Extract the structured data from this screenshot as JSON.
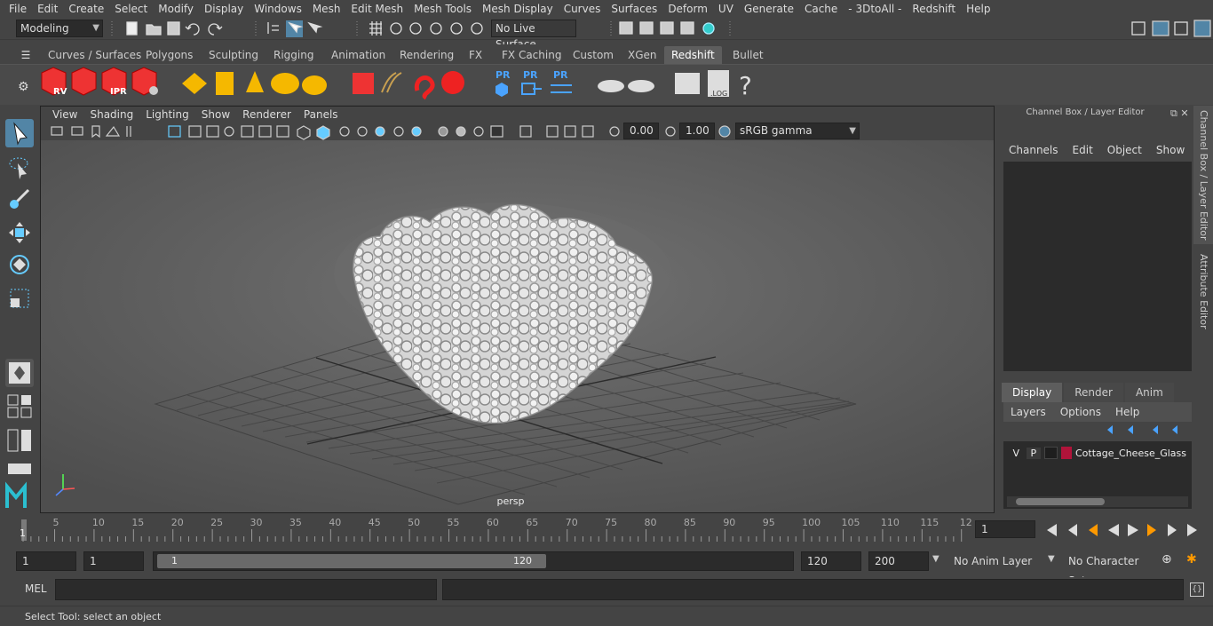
{
  "menubar": {
    "items": [
      "File",
      "Edit",
      "Create",
      "Select",
      "Modify",
      "Display",
      "Windows",
      "Mesh",
      "Edit Mesh",
      "Mesh Tools",
      "Mesh Display",
      "Curves",
      "Surfaces",
      "Deform",
      "UV",
      "Generate",
      "Cache",
      "- 3DtoAll -",
      "Redshift",
      "Help"
    ]
  },
  "statusline": {
    "mode": "Modeling",
    "live_surface": "No Live Surface"
  },
  "shelf": {
    "tabs": [
      "Curves / Surfaces",
      "Polygons",
      "Sculpting",
      "Rigging",
      "Animation",
      "Rendering",
      "FX",
      "FX Caching",
      "Custom",
      "XGen",
      "Redshift",
      "Bullet"
    ],
    "active": "Redshift",
    "icon_labels": {
      "rv": "RV",
      "ipr": "IPR",
      "pr1": "PR",
      "pr2": "PR",
      "pr3": "PR",
      "log": ".LOG",
      "help": "?"
    }
  },
  "panel": {
    "menus": [
      "View",
      "Shading",
      "Lighting",
      "Show",
      "Renderer",
      "Panels"
    ],
    "exposure": "0.00",
    "gamma": "1.00",
    "color_space": "sRGB gamma",
    "camera": "persp"
  },
  "channelbox": {
    "title": "Channel Box / Layer Editor",
    "menus": [
      "Channels",
      "Edit",
      "Object",
      "Show"
    ],
    "layer_tabs": [
      "Display",
      "Render",
      "Anim"
    ],
    "active_layer_tab": "Display",
    "layer_menus": [
      "Layers",
      "Options",
      "Help"
    ],
    "layer": {
      "v": "V",
      "p": "P",
      "name": "Cottage_Cheese_Glass",
      "color": "#b0143a"
    }
  },
  "side_tabs": [
    "Channel Box / Layer Editor",
    "Attribute Editor"
  ],
  "timeline": {
    "ticks": [
      "5",
      "10",
      "15",
      "20",
      "25",
      "30",
      "35",
      "40",
      "45",
      "50",
      "55",
      "60",
      "65",
      "70",
      "75",
      "80",
      "85",
      "90",
      "95",
      "100",
      "105",
      "110",
      "115",
      "12"
    ],
    "start_label": "1",
    "current_frame": "1"
  },
  "range": {
    "start": "1",
    "anim_start": "1",
    "slider_start": "1",
    "slider_end": "120",
    "end": "120",
    "anim_end": "200",
    "anim_layer": "No Anim Layer",
    "character_set": "No Character Set"
  },
  "cmdline": {
    "language": "MEL"
  },
  "helpline": {
    "text": "Select Tool: select an object"
  },
  "colors": {
    "accent": "#5285a6",
    "active_tab": "#5d5d5d",
    "viewport": "#6a6a6a"
  }
}
